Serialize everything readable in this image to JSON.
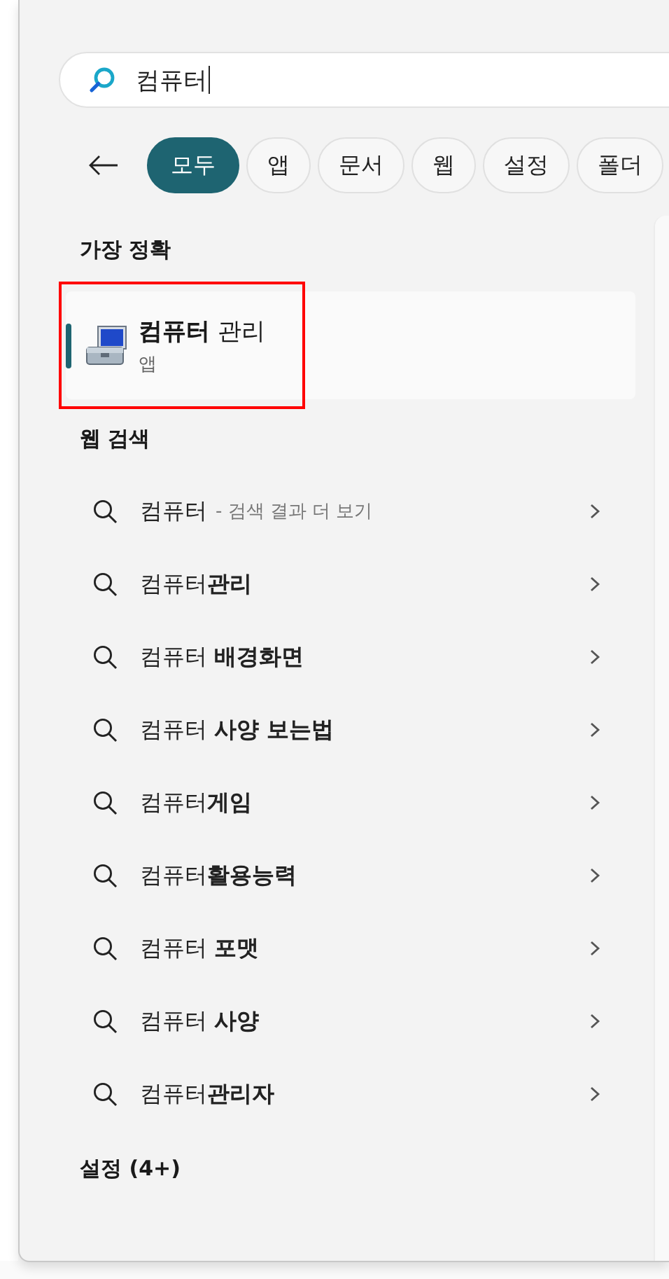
{
  "search": {
    "value": "컴퓨터"
  },
  "filters": [
    {
      "label": "모두",
      "selected": true
    },
    {
      "label": "앱",
      "selected": false
    },
    {
      "label": "문서",
      "selected": false
    },
    {
      "label": "웹",
      "selected": false
    },
    {
      "label": "설정",
      "selected": false
    },
    {
      "label": "폴더",
      "selected": false
    }
  ],
  "best_match": {
    "heading": "가장 정확",
    "title": "**컴퓨터** 관리",
    "type": "앱",
    "selected": true
  },
  "web_search": {
    "heading": "웹 검색",
    "items": [
      {
        "text": "컴퓨터",
        "hint": "- 검색 결과 더 보기"
      },
      {
        "text": "컴퓨터**관리**"
      },
      {
        "text": "컴퓨터 **배경화면**"
      },
      {
        "text": "컴퓨터 **사양 보는법**"
      },
      {
        "text": "컴퓨터**게임**"
      },
      {
        "text": "컴퓨터**활용능력**"
      },
      {
        "text": "컴퓨터 **포맷**"
      },
      {
        "text": "컴퓨터 **사양**"
      },
      {
        "text": "컴퓨터**관리자**"
      }
    ]
  },
  "settings": {
    "heading": "설정 (4+)"
  }
}
